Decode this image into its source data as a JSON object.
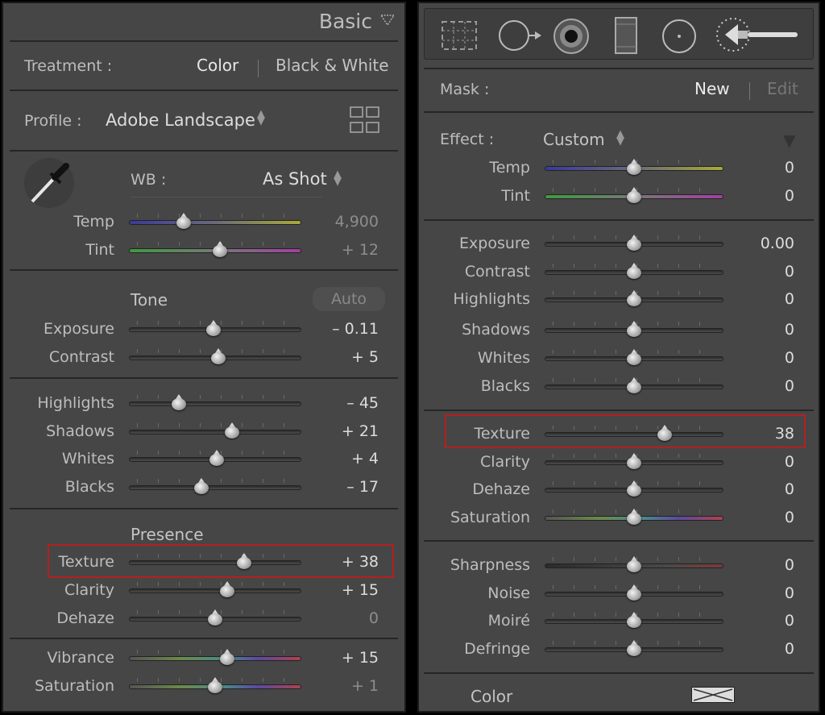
{
  "left": {
    "header": {
      "title": "Basic"
    },
    "treatment": {
      "label": "Treatment :",
      "options": [
        "Color",
        "Black & White"
      ]
    },
    "profile": {
      "label": "Profile :",
      "value": "Adobe Landscape"
    },
    "wb": {
      "label": "WB :",
      "value": "As Shot"
    },
    "wb_sliders": [
      {
        "label": "Temp",
        "value": "4,900",
        "pos": 0.32,
        "style": "temp"
      },
      {
        "label": "Tint",
        "value": "+ 12",
        "pos": 0.53,
        "style": "tint"
      }
    ],
    "tone": {
      "title": "Tone",
      "auto": "Auto"
    },
    "tone_sliders": [
      {
        "label": "Exposure",
        "value": "– 0.11",
        "pos": 0.49
      },
      {
        "label": "Contrast",
        "value": "+ 5",
        "pos": 0.52
      }
    ],
    "range_sliders": [
      {
        "label": "Highlights",
        "value": "– 45",
        "pos": 0.29
      },
      {
        "label": "Shadows",
        "value": "+ 21",
        "pos": 0.6
      },
      {
        "label": "Whites",
        "value": "+ 4",
        "pos": 0.51
      },
      {
        "label": "Blacks",
        "value": "– 17",
        "pos": 0.42
      }
    ],
    "presence": {
      "title": "Presence"
    },
    "presence_sliders": [
      {
        "label": "Texture",
        "value": "+ 38",
        "pos": 0.67
      },
      {
        "label": "Clarity",
        "value": "+ 15",
        "pos": 0.57
      },
      {
        "label": "Dehaze",
        "value": "0",
        "pos": 0.5
      }
    ],
    "color_sliders": [
      {
        "label": "Vibrance",
        "value": "+ 15",
        "pos": 0.57,
        "style": "vib"
      },
      {
        "label": "Saturation",
        "value": "+ 1",
        "pos": 0.5,
        "style": "vib"
      }
    ]
  },
  "right": {
    "tools": [
      "crop-overlay-icon",
      "spot-removal-icon",
      "red-eye-icon",
      "graduated-filter-icon",
      "radial-filter-icon",
      "adjustment-brush-icon"
    ],
    "mask": {
      "label": "Mask :",
      "new": "New",
      "edit": "Edit"
    },
    "effect": {
      "label": "Effect :",
      "value": "Custom"
    },
    "wb_sliders": [
      {
        "label": "Temp",
        "value": "0",
        "style": "temp"
      },
      {
        "label": "Tint",
        "value": "0",
        "style": "tint"
      }
    ],
    "tone_sliders": [
      {
        "label": "Exposure",
        "value": "0.00"
      },
      {
        "label": "Contrast",
        "value": "0"
      },
      {
        "label": "Highlights",
        "value": "0"
      },
      {
        "label": "Shadows",
        "value": "0"
      },
      {
        "label": "Whites",
        "value": "0"
      },
      {
        "label": "Blacks",
        "value": "0"
      }
    ],
    "presence_sliders": [
      {
        "label": "Texture",
        "value": "38",
        "pos": 0.67
      },
      {
        "label": "Clarity",
        "value": "0"
      },
      {
        "label": "Dehaze",
        "value": "0"
      },
      {
        "label": "Saturation",
        "value": "0",
        "style": "vib"
      }
    ],
    "detail_sliders": [
      {
        "label": "Sharpness",
        "value": "0",
        "style": "sharp"
      },
      {
        "label": "Noise",
        "value": "0"
      },
      {
        "label": "Moiré",
        "value": "0"
      },
      {
        "label": "Defringe",
        "value": "0"
      }
    ],
    "color": {
      "label": "Color"
    }
  },
  "colors": {
    "highlight_box": "#b32020",
    "panel": "#464646"
  }
}
